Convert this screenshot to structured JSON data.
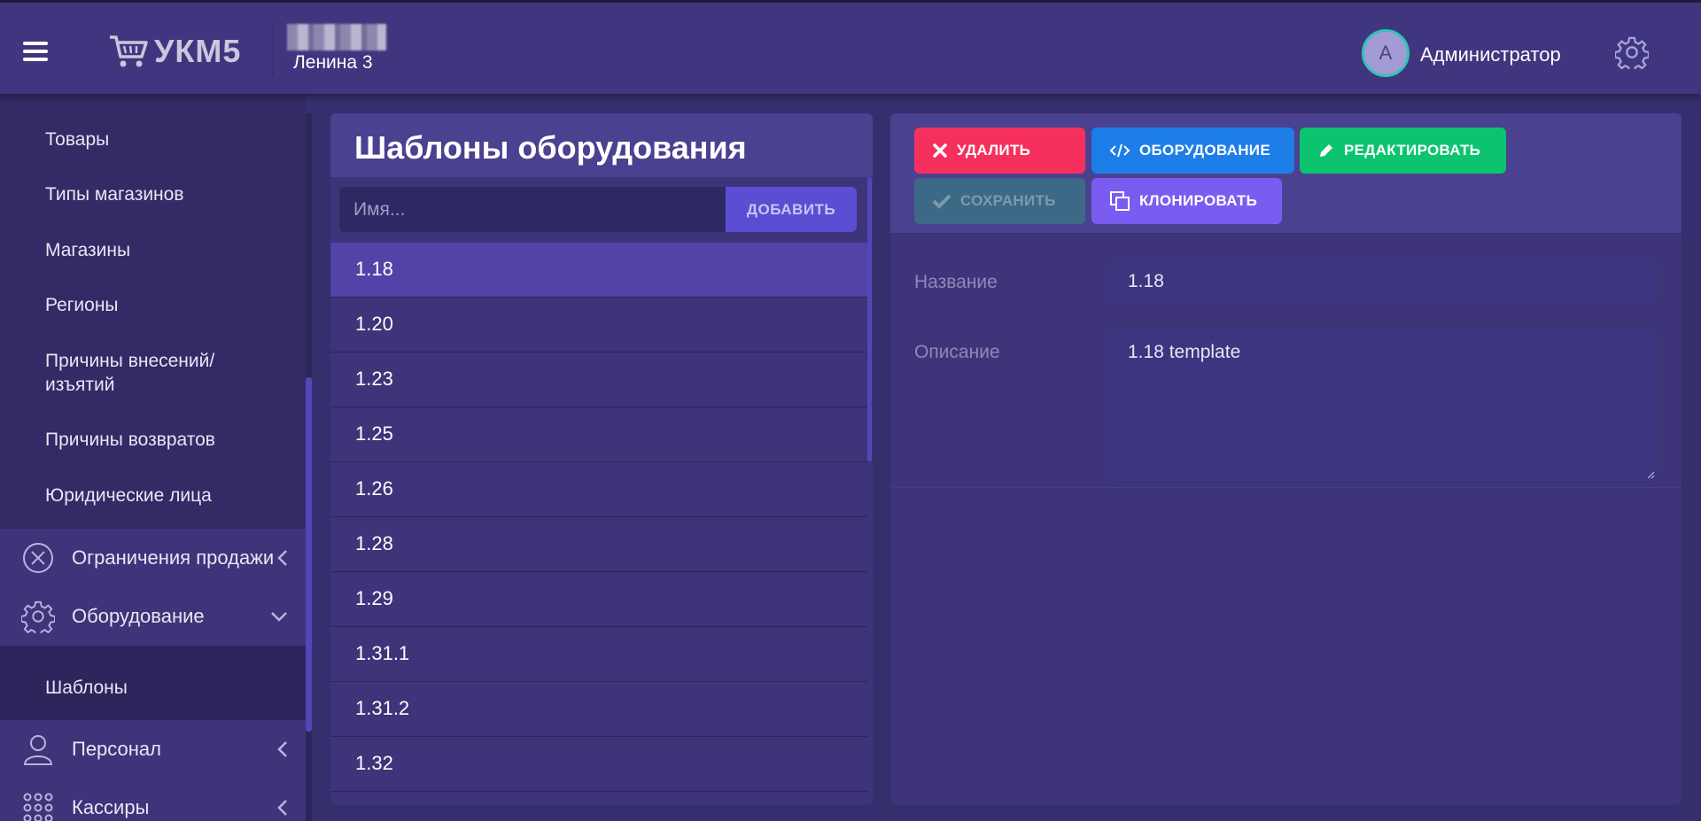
{
  "header": {
    "logo_text": "УКМ5",
    "store_name": "Ленина 3",
    "user_initial": "A",
    "user_name": "Администратор"
  },
  "sidebar": {
    "subitems": [
      "Товары",
      "Типы магазинов",
      "Магазины",
      "Регионы",
      "Причины внесений/ изъятий",
      "Причины возвратов",
      "Юридические лица"
    ],
    "groups": {
      "sales_limits": "Ограничения продажи",
      "equipment": "Оборудование",
      "equipment_sub": "Шаблоны",
      "staff": "Персонал",
      "cashiers": "Кассиры"
    }
  },
  "templates": {
    "title": "Шаблоны оборудования",
    "name_placeholder": "Имя...",
    "add_label": "ДОБАВИТЬ",
    "items": [
      "1.18",
      "1.20",
      "1.23",
      "1.25",
      "1.26",
      "1.28",
      "1.29",
      "1.31.1",
      "1.31.2",
      "1.32"
    ],
    "selected": "1.18"
  },
  "toolbar": {
    "delete": "УДАЛИТЬ",
    "equipment": "ОБОРУДОВАНИЕ",
    "edit": "РЕДАКТИРОВАТЬ",
    "save": "СОХРАНИТЬ",
    "clone": "КЛОНИРОВАТЬ"
  },
  "form": {
    "name_label": "Название",
    "name_value": "1.18",
    "desc_label": "Описание",
    "desc_value": "1.18 template"
  },
  "colors": {
    "accent": "#5b4ed3",
    "delete": "#f5305d",
    "equipment": "#1d7ee8",
    "edit": "#0cc470",
    "clone": "#7a5df0",
    "selected_row": "#5343a8"
  },
  "icons": [
    "hamburger-icon",
    "cart-icon",
    "settings-icon",
    "cancel-circle-icon",
    "gear-icon",
    "user-icon",
    "grid-icon",
    "times-icon",
    "code-icon",
    "pencil-icon",
    "check-icon",
    "clone-icon"
  ]
}
